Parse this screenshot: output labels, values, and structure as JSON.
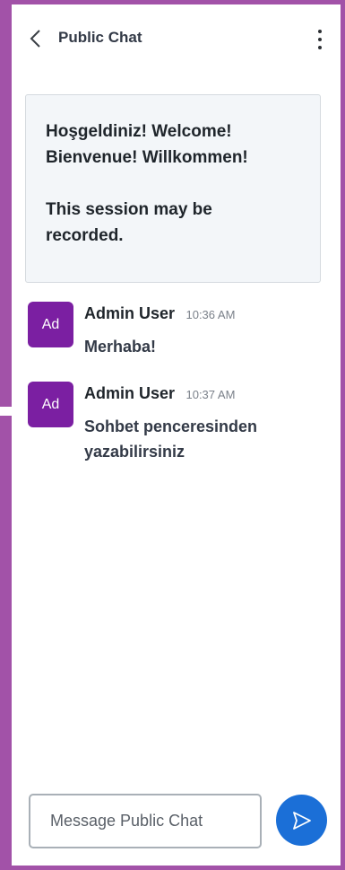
{
  "header": {
    "title": "Public Chat"
  },
  "welcome": {
    "line1": "Hoşgeldiniz! Welcome!",
    "line2": "Bienvenue! Willkommen!",
    "line3": "This session may be",
    "line4": "recorded."
  },
  "messages": [
    {
      "avatar": "Ad",
      "author": "Admin User",
      "time": "10:36 AM",
      "text": "Merhaba!"
    },
    {
      "avatar": "Ad",
      "author": "Admin User",
      "time": "10:37 AM",
      "text": "Sohbet penceresinden yazabilirsiniz"
    }
  ],
  "composer": {
    "placeholder": "Message Public Chat"
  },
  "colors": {
    "accent": "#a252a8",
    "avatar": "#7b1fa2",
    "send": "#1b6fd7"
  }
}
